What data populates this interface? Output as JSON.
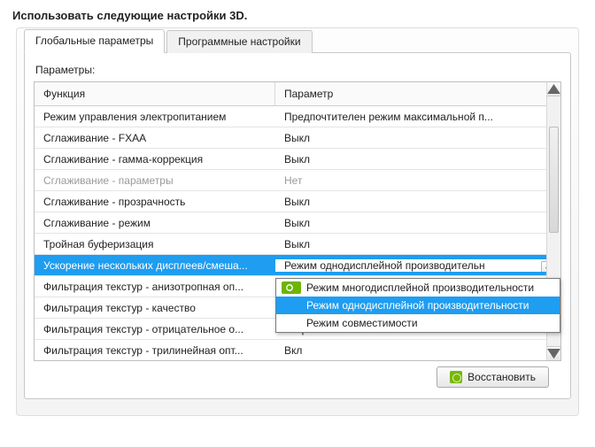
{
  "title": "Использовать следующие настройки 3D.",
  "tabs": {
    "global": "Глобальные параметры",
    "program": "Программные настройки"
  },
  "section_label": "Параметры:",
  "columns": {
    "func": "Функция",
    "param": "Параметр"
  },
  "rows": [
    {
      "func": "Режим управления электропитанием",
      "param": "Предпочтителен режим максимальной п...",
      "state": ""
    },
    {
      "func": "Сглаживание - FXAA",
      "param": "Выкл",
      "state": ""
    },
    {
      "func": "Сглаживание - гамма-коррекция",
      "param": "Выкл",
      "state": ""
    },
    {
      "func": "Сглаживание - параметры",
      "param": "Нет",
      "state": "disabled"
    },
    {
      "func": "Сглаживание - прозрачность",
      "param": "Выкл",
      "state": ""
    },
    {
      "func": "Сглаживание - режим",
      "param": "Выкл",
      "state": ""
    },
    {
      "func": "Тройная буферизация",
      "param": "Выкл",
      "state": ""
    },
    {
      "func": "Ускорение нескольких дисплеев/смеша...",
      "param": "Режим однодисплейной производительн",
      "state": "selected"
    },
    {
      "func": "Фильтрация текстур - анизотропная оп...",
      "param": "",
      "state": ""
    },
    {
      "func": "Фильтрация текстур - качество",
      "param": "",
      "state": ""
    },
    {
      "func": "Фильтрация текстур - отрицательное о...",
      "param": "Разрешить",
      "state": ""
    },
    {
      "func": "Фильтрация текстур - трилинейная опт...",
      "param": "Вкл",
      "state": ""
    }
  ],
  "dropdown": {
    "items": [
      "Режим многодисплейной производительности",
      "Режим однодисплейной производительности",
      "Режим совместимости"
    ],
    "highlight_index": 1
  },
  "restore_label": "Восстановить"
}
